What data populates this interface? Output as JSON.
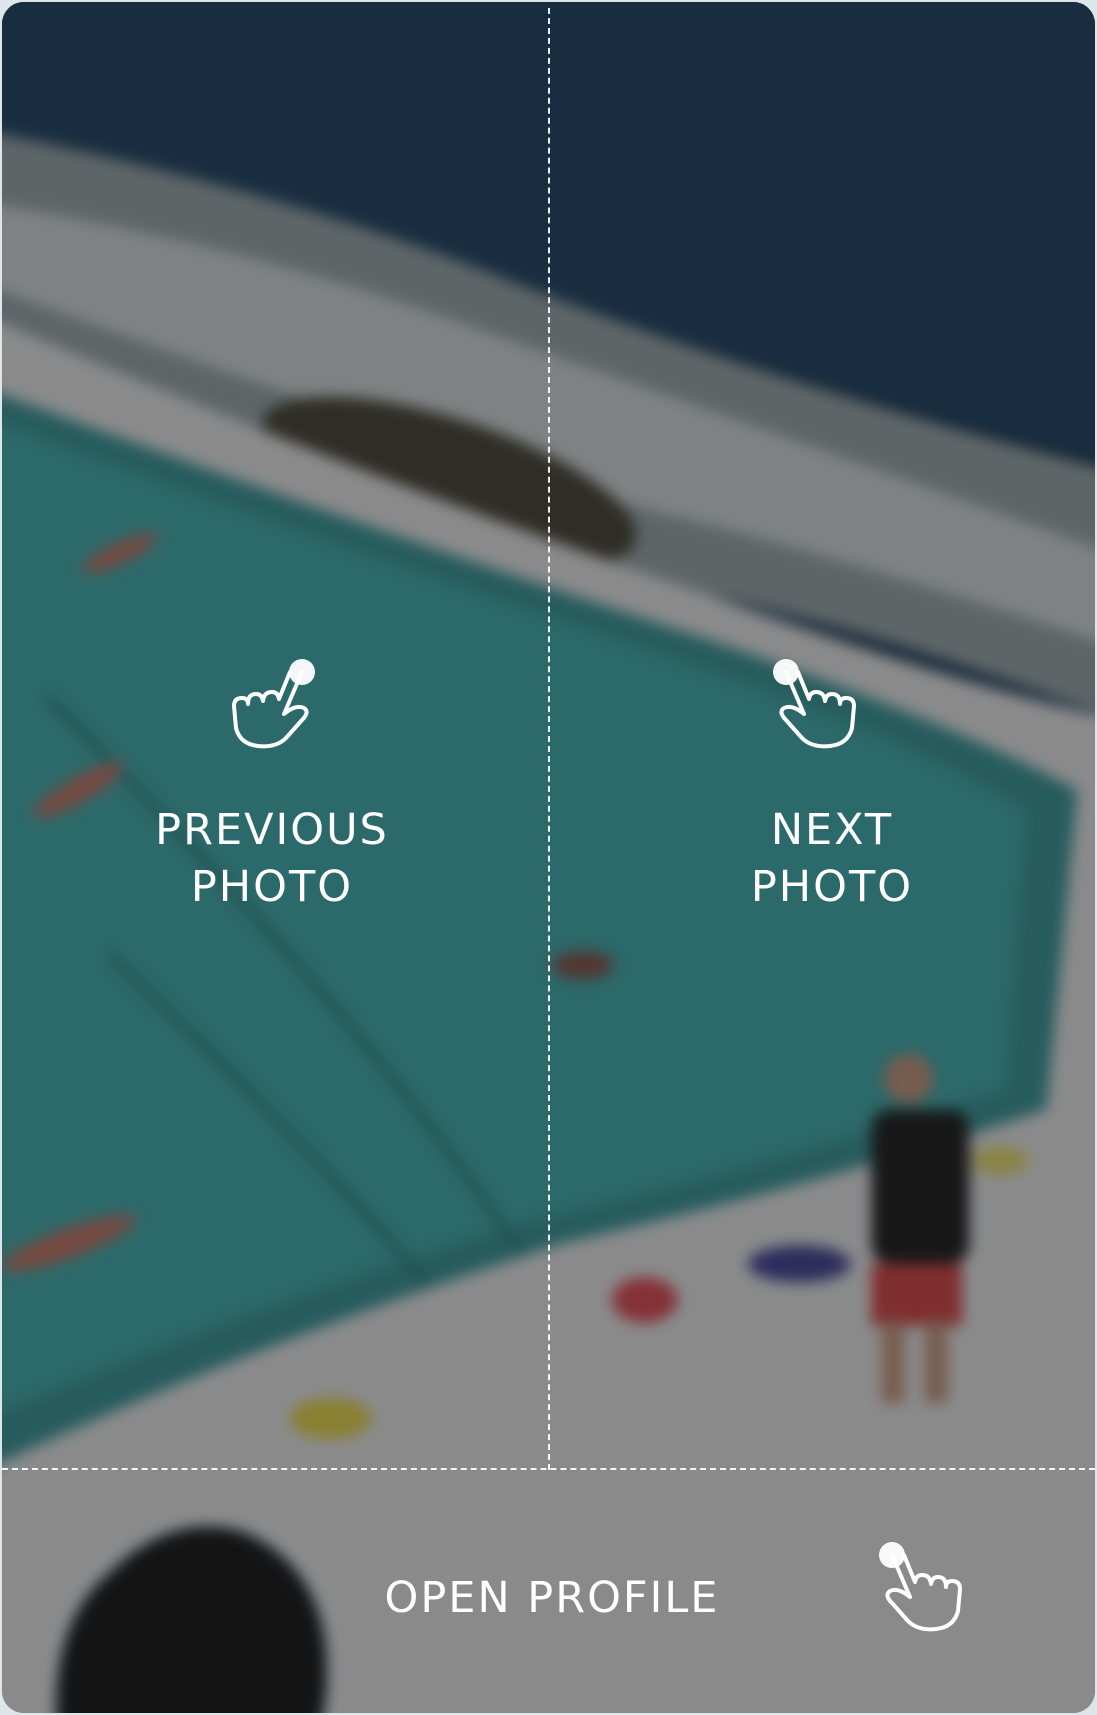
{
  "overlay": {
    "previous": {
      "lines": [
        "PREVIOUS",
        "PHOTO"
      ],
      "icon": "tap-hand-icon"
    },
    "next": {
      "lines": [
        "NEXT",
        "PHOTO"
      ],
      "icon": "tap-hand-icon"
    },
    "profile": {
      "label": "OPEN PROFILE",
      "icon": "tap-hand-icon"
    }
  },
  "colors": {
    "text": "#ffffff",
    "divider": "#ffffff",
    "dim_overlay": "#1c1c1e"
  }
}
